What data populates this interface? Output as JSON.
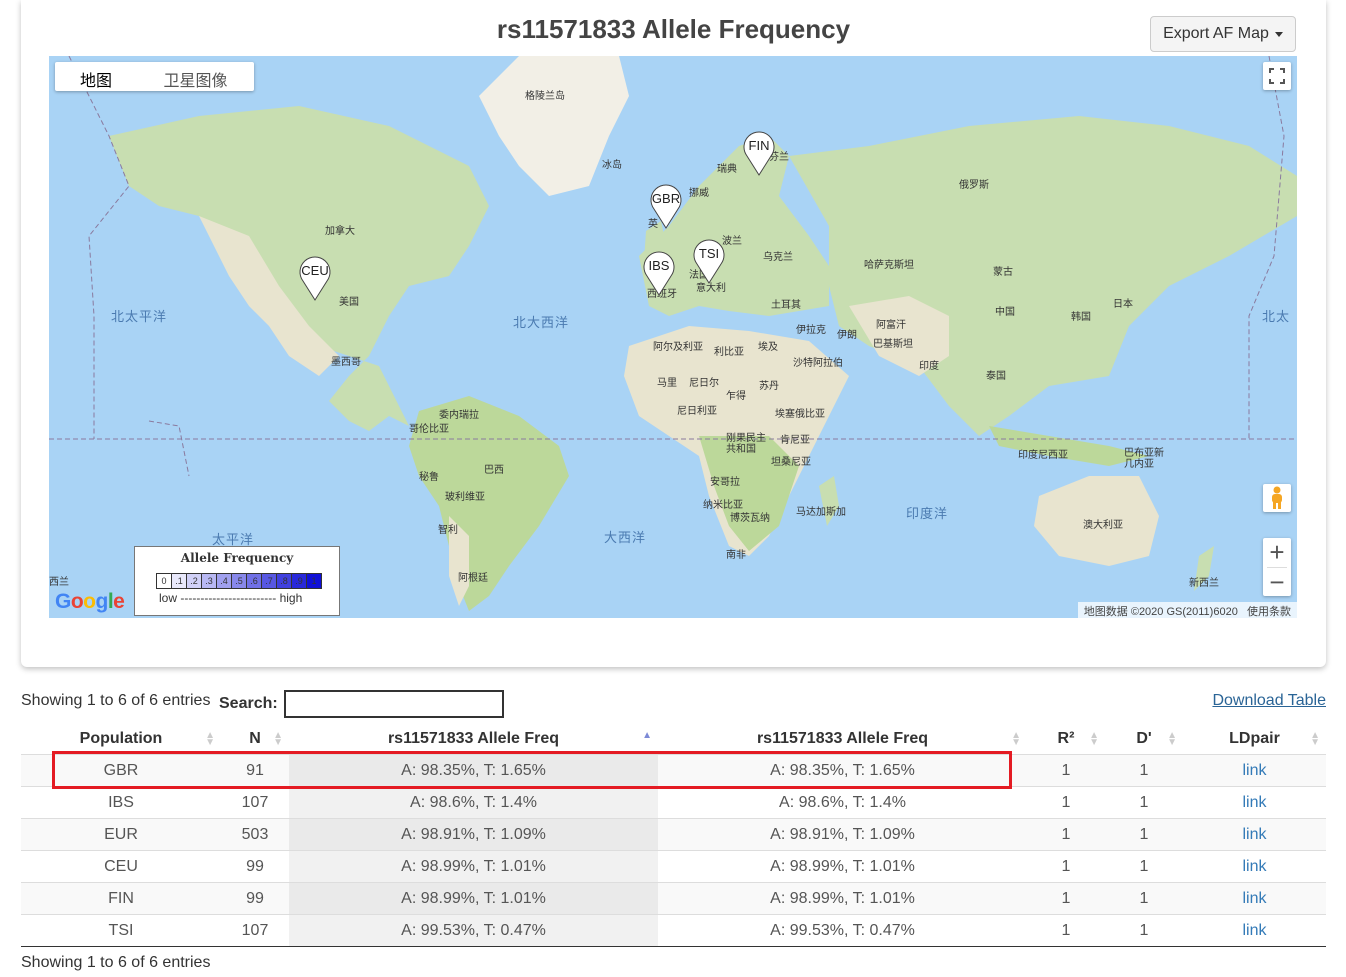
{
  "page": {
    "title": "rs11571833 Allele Frequency",
    "export_label": "Export AF Map"
  },
  "map": {
    "type_tabs": [
      "地图",
      "卫星图像"
    ],
    "country_labels": [
      "格陵兰岛",
      "冰岛",
      "瑞典",
      "挪威",
      "芬兰",
      "俄罗斯",
      "加拿大",
      "美国",
      "墨西哥",
      "波兰",
      "乌克兰",
      "哈萨克斯坦",
      "蒙古",
      "中国",
      "日本",
      "韩国",
      "土耳其",
      "伊拉克",
      "伊朗",
      "阿富汗",
      "巴基斯坦",
      "印度",
      "泰国",
      "阿尔及利亚",
      "利比亚",
      "埃及",
      "沙特阿拉伯",
      "马里",
      "尼日尔",
      "乍得",
      "苏丹",
      "尼日利亚",
      "埃塞俄比亚",
      "肯尼亚",
      "刚果民主共和国",
      "坦桑尼亚",
      "安哥拉",
      "纳米比亚",
      "博茨瓦纳",
      "马达加斯加",
      "南非",
      "委内瑞拉",
      "哥伦比亚",
      "秘鲁",
      "巴西",
      "玻利维亚",
      "智利",
      "阿根廷",
      "印度尼西亚",
      "巴布亚新几内亚",
      "澳大利亚",
      "新西兰",
      "法国",
      "意大利",
      "西班牙",
      "英",
      "西兰"
    ],
    "ocean_labels": [
      "北太平洋",
      "北大西洋",
      "太平洋",
      "大西洋",
      "印度洋",
      "北太"
    ],
    "markers": [
      "FIN",
      "GBR",
      "CEU",
      "IBS",
      "TSI"
    ],
    "legend": {
      "title": "Allele Frequency",
      "scale": [
        "0",
        ".1",
        ".2",
        ".3",
        ".4",
        ".5",
        ".6",
        ".7",
        ".8",
        ".9",
        "1"
      ],
      "low_high": "low ------------------------ high"
    },
    "logo": "Google",
    "attribution": "地图数据 ©2020 GS(2011)6020",
    "terms": "使用条款",
    "zoom_in": "+",
    "zoom_out": "−"
  },
  "table_controls": {
    "info_top": "Showing 1 to 6 of 6 entries",
    "search_label": "Search:",
    "search_value": "",
    "download_label": "Download Table",
    "info_bottom": "Showing 1 to 6 of 6 entries"
  },
  "table": {
    "headers": [
      "Population",
      "N",
      "rs11571833 Allele Freq",
      "rs11571833 Allele Freq",
      "R²",
      "D'",
      "LDpair"
    ],
    "rows": [
      {
        "pop": "GBR",
        "n": "91",
        "af1": "A: 98.35%, T: 1.65%",
        "af2": "A: 98.35%, T: 1.65%",
        "r2": "1",
        "d": "1",
        "link": "link"
      },
      {
        "pop": "IBS",
        "n": "107",
        "af1": "A: 98.6%, T: 1.4%",
        "af2": "A: 98.6%, T: 1.4%",
        "r2": "1",
        "d": "1",
        "link": "link"
      },
      {
        "pop": "EUR",
        "n": "503",
        "af1": "A: 98.91%, T: 1.09%",
        "af2": "A: 98.91%, T: 1.09%",
        "r2": "1",
        "d": "1",
        "link": "link"
      },
      {
        "pop": "CEU",
        "n": "99",
        "af1": "A: 98.99%, T: 1.01%",
        "af2": "A: 98.99%, T: 1.01%",
        "r2": "1",
        "d": "1",
        "link": "link"
      },
      {
        "pop": "FIN",
        "n": "99",
        "af1": "A: 98.99%, T: 1.01%",
        "af2": "A: 98.99%, T: 1.01%",
        "r2": "1",
        "d": "1",
        "link": "link"
      },
      {
        "pop": "TSI",
        "n": "107",
        "af1": "A: 99.53%, T: 0.47%",
        "af2": "A: 99.53%, T: 0.47%",
        "r2": "1",
        "d": "1",
        "link": "link"
      }
    ]
  },
  "colors": {
    "highlight": "#e41b23",
    "link": "#337ab7",
    "ocean": "#a9d3f5"
  }
}
